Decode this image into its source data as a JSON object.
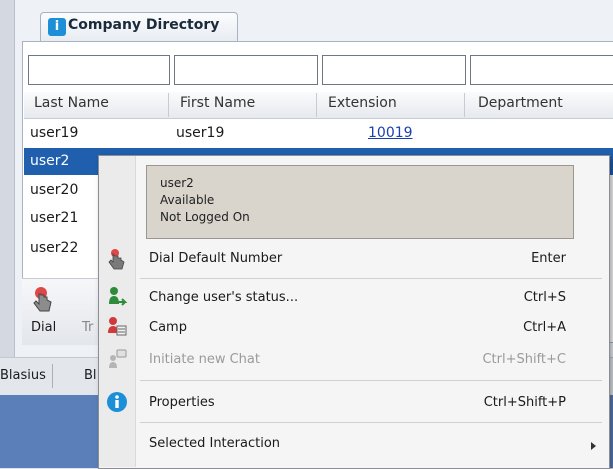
{
  "tab": {
    "title": "Company Directory"
  },
  "columns": [
    "Last Name",
    "First Name",
    "Extension",
    "Department"
  ],
  "rows": [
    {
      "last": "user19",
      "first": "user19",
      "ext": "10019"
    },
    {
      "last": "user2",
      "first": "",
      "ext": ""
    },
    {
      "last": "user20"
    },
    {
      "last": "user21"
    },
    {
      "last": "user22"
    }
  ],
  "toolbar": {
    "dial": "Dial",
    "transfer": "Tr"
  },
  "strip": {
    "tab1": "Blasius",
    "tab2": "Bl"
  },
  "menu": {
    "info": [
      "user2",
      "Available",
      "Not Logged On"
    ],
    "items": [
      {
        "label": "Dial Default Number",
        "shortcut": "Enter"
      },
      {
        "label": "Change user's status...",
        "shortcut": "Ctrl+S"
      },
      {
        "label": "Camp",
        "shortcut": "Ctrl+A"
      },
      {
        "label": "Initiate new Chat",
        "shortcut": "Ctrl+Shift+C"
      },
      {
        "label": "Properties",
        "shortcut": "Ctrl+Shift+P"
      },
      {
        "label": "Selected Interaction",
        "shortcut": ""
      }
    ]
  },
  "colors": {
    "selection": "#1f5fae",
    "link": "#1b3fb0",
    "info_icon": "#1d8fd8"
  }
}
